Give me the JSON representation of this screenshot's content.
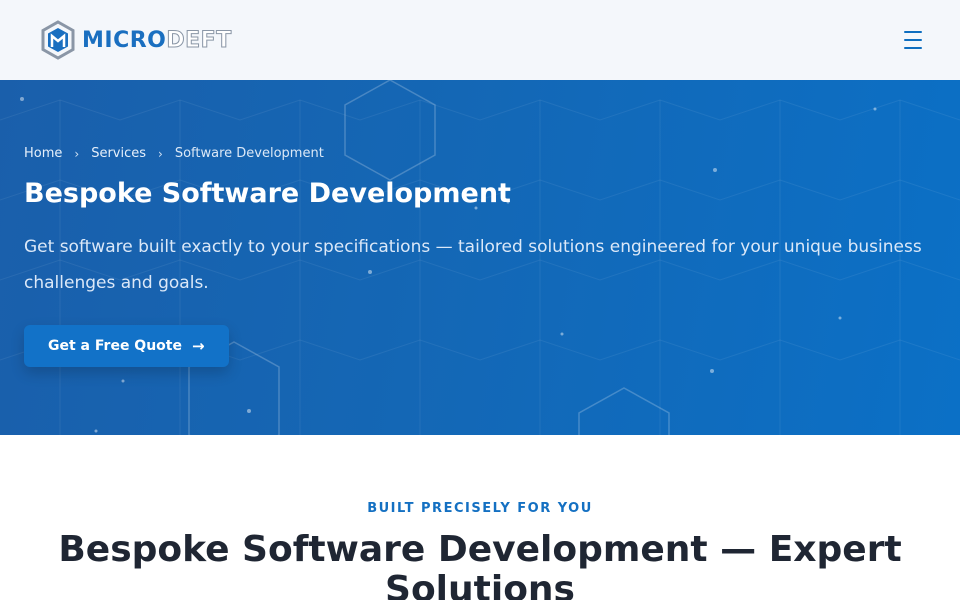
{
  "header": {
    "logo_part1": "MICRO",
    "logo_part2": "DEFT",
    "menu_icon": "hamburger-menu-icon"
  },
  "hero": {
    "breadcrumb": [
      "Home",
      "Services",
      "Software Development"
    ],
    "breadcrumb_separator": "›",
    "title": "Bespoke Software Development",
    "subtitle": "Get software built exactly to your specifications — tailored solutions engineered for your unique business challenges and goals.",
    "cta_label": "Get a Free Quote",
    "cta_icon": "arrow-right-icon"
  },
  "section": {
    "eyebrow": "BUILT PRECISELY FOR YOU",
    "title": "Bespoke Software Development — Expert Solutions"
  },
  "colors": {
    "accent": "#1272c8",
    "hero_bg": "#1467b5",
    "heading": "#1f2633",
    "header_bg": "#f4f7fb"
  }
}
